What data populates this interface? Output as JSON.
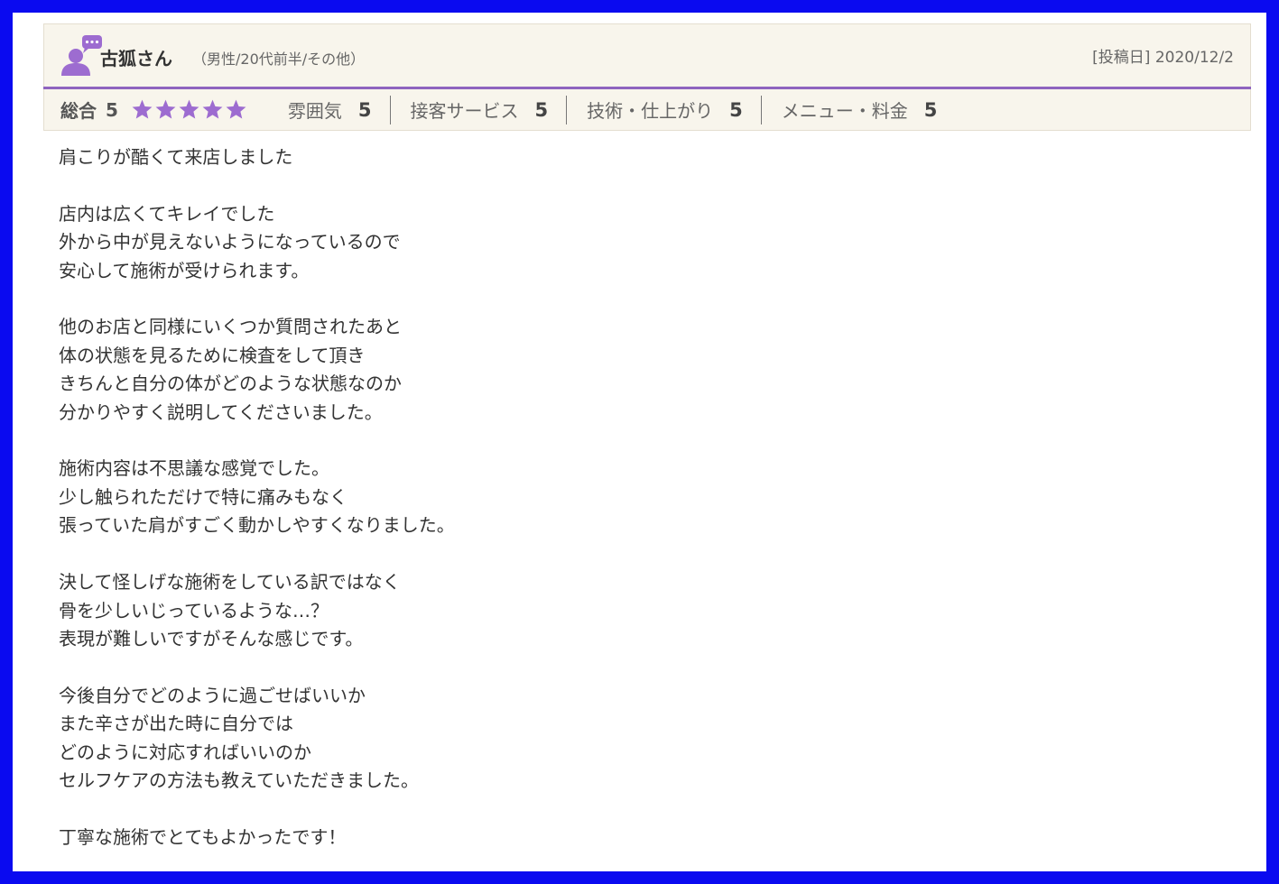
{
  "reviewer": {
    "name": "古狐さん",
    "meta": "（男性/20代前半/その他）"
  },
  "post_date": "[投稿日] 2020/12/2",
  "ratings": {
    "overall_label": "総合",
    "overall_score": "5",
    "stars_filled": 5,
    "stars_total": 5,
    "categories": [
      {
        "label": "雰囲気",
        "score": "5"
      },
      {
        "label": "接客サービス",
        "score": "5"
      },
      {
        "label": "技術・仕上がり",
        "score": "5"
      },
      {
        "label": "メニュー・料金",
        "score": "5"
      }
    ]
  },
  "colors": {
    "accent": "#8f64bf",
    "star": "#9d6cd0",
    "border": "#0a0af0",
    "header_bg": "#f8f5ec"
  },
  "icons": {
    "avatar": "user-speech-bubble-icon",
    "star": "star-icon"
  },
  "review_text": "肩こりが酷くて来店しました\n\n店内は広くてキレイでした\n外から中が見えないようになっているので\n安心して施術が受けられます。\n\n他のお店と同様にいくつか質問されたあと\n体の状態を見るために検査をして頂き\nきちんと自分の体がどのような状態なのか\n分かりやすく説明してくださいました。\n\n施術内容は不思議な感覚でした。\n少し触られただけで特に痛みもなく\n張っていた肩がすごく動かしやすくなりました。\n\n決して怪しげな施術をしている訳ではなく\n骨を少しいじっているような…？\n表現が難しいですがそんな感じです。\n\n今後自分でどのように過ごせばいいか\nまた辛さが出た時に自分では\nどのように対応すればいいのか\nセルフケアの方法も教えていただきました。\n\n丁寧な施術でとてもよかったです！"
}
